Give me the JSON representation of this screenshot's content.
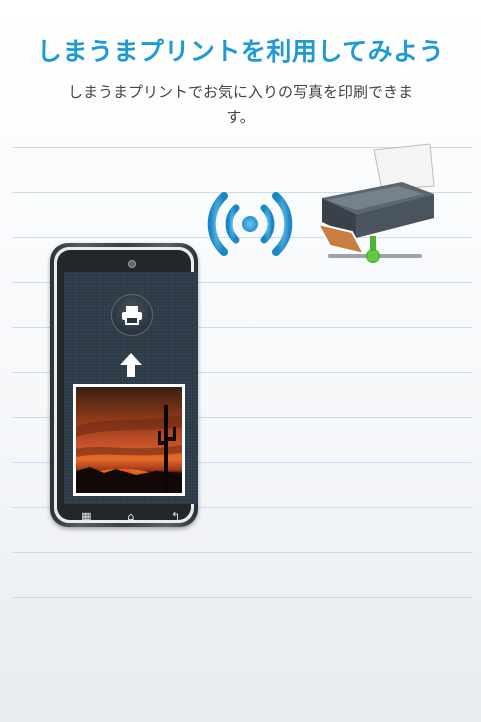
{
  "header": {
    "title": "しまうまプリントを利用してみよう",
    "subtitle": "しまうまプリントでお気に入りの写真を印刷できます。"
  },
  "illustration": {
    "wireless_icon": "wifi-signal-icon",
    "printer_icon": "network-printer-icon",
    "phone": {
      "print_button_icon": "printer-icon",
      "arrow_icon": "arrow-up-icon",
      "photo": "sunset-cactus-photo",
      "nav_keys": [
        {
          "icon": "grid-menu-icon",
          "glyph": "▦"
        },
        {
          "icon": "home-icon",
          "glyph": "⌂"
        },
        {
          "icon": "back-icon",
          "glyph": "↰"
        }
      ]
    }
  },
  "colors": {
    "title": "#1f9ad6",
    "ruled_line": "#c9dcf2",
    "wifi": "#1f9ad6",
    "network_node": "#4fb334"
  }
}
